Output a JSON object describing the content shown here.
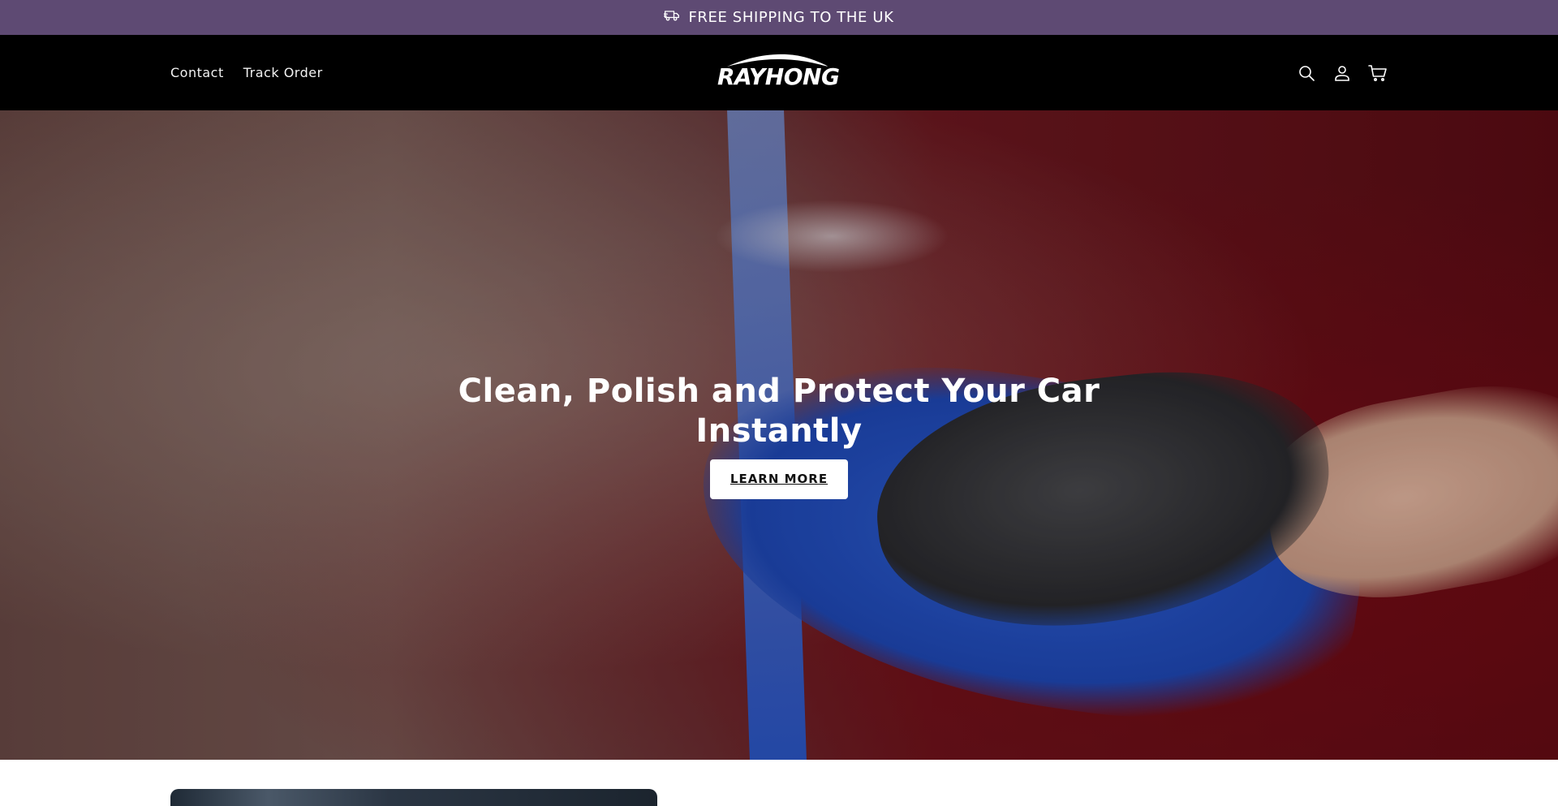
{
  "announcement": {
    "text": "FREE SHIPPING TO THE UK",
    "icon": "truck-icon"
  },
  "header": {
    "nav": [
      {
        "label": "Contact"
      },
      {
        "label": "Track Order"
      }
    ],
    "logo_text": "RAYHONG",
    "icons": [
      "search-icon",
      "account-icon",
      "cart-icon"
    ]
  },
  "hero": {
    "title": "Clean, Polish and Protect Your Car Instantly",
    "button_label": "LEARN MORE"
  },
  "colors": {
    "announcement_bg": "#5e4a73",
    "header_bg": "#000000",
    "button_bg": "#ffffff"
  }
}
